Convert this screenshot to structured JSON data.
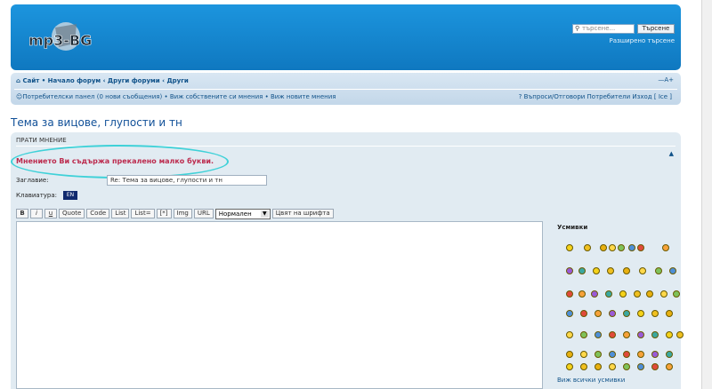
{
  "header": {
    "logo_text": "mp3-BG",
    "search_placeholder": "търсене...",
    "search_button": "Търсене",
    "advanced_search": "Разширено търсене"
  },
  "navbar": {
    "breadcrumb": "Сайт • Начало форум ‹ Други форуми ‹ Други",
    "font_resize": "—A+",
    "left_links": "Потребителски панел (0 нови съобщения) • Виж собствените си мнения • Виж новите мнения",
    "right_links": "Въпроси/Отговори  Потребители  Изход [ Ice ]"
  },
  "topic": {
    "title": "Тема за вицове, глупости и тн"
  },
  "post_panel": {
    "heading": "Прати мнение",
    "arrow": "▲",
    "error": "Мнението Ви съдържа прекалено малко букви.",
    "subject_label": "Заглавие:",
    "subject_value": "Re: Тема за вицове, глупости и тн",
    "keyboard_label": "Клавиатура:",
    "keyboard_value": "EN",
    "toolbar": {
      "buttons": [
        "B",
        "i",
        "u",
        "Quote",
        "Code",
        "List",
        "List=",
        "[*]",
        "Img",
        "URL"
      ],
      "font_size": "Нормален",
      "font_color": "Цвят на шрифта"
    },
    "smilies_title": "Усмивки",
    "all_smilies": "Виж всички усмивки"
  },
  "colors": {
    "header_blue": "#1a8fd8",
    "nav_bg": "#c9dcec",
    "panel_bg": "#e1ebf2",
    "error_red": "#bc2a4d",
    "highlight_cyan": "#3fd1d8"
  }
}
